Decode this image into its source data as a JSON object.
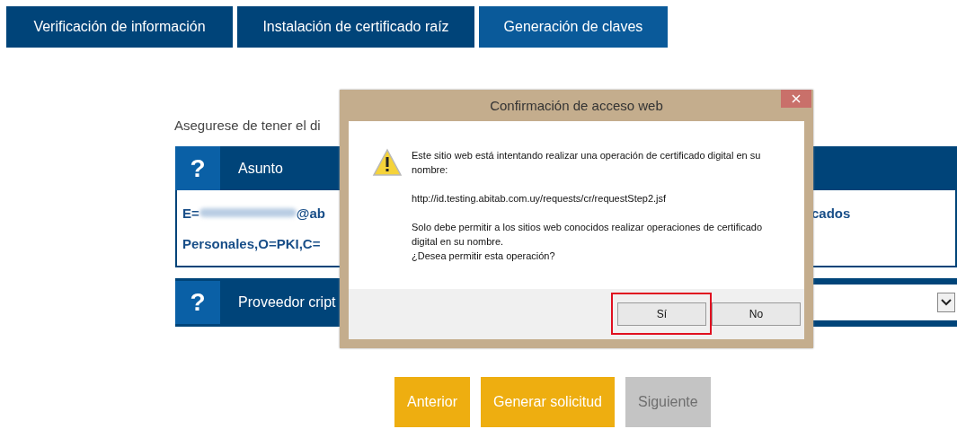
{
  "tabs": [
    {
      "label": "Verificación de información",
      "selected": false
    },
    {
      "label": "Instalación de certificado raíz",
      "selected": false
    },
    {
      "label": "Generación de claves",
      "selected": true
    }
  ],
  "intro": "Asegurese de tener el di",
  "subject_panel": {
    "help_mark": "?",
    "title": "Asunto",
    "line_1_start": "E=",
    "line_1_after_redaction": "@ab",
    "line_1_end": "cados",
    "line_2": "Personales,O=PKI,C="
  },
  "provider_panel": {
    "help_mark": "?",
    "title": "Proveedor cript"
  },
  "buttons": [
    {
      "label": "Anterior",
      "disabled": false
    },
    {
      "label": "Generar solicitud",
      "disabled": false
    },
    {
      "label": "Siguiente",
      "disabled": true
    }
  ],
  "dialog": {
    "title": "Confirmación de acceso web",
    "message": "Este sitio web está intentando realizar una operación de certificado digital en su nombre:",
    "url": "http://id.testing.abitab.com.uy/requests/cr/requestStep2.jsf",
    "warning": "Solo debe permitir a los sitios web conocidos realizar operaciones de certificado digital en su nombre.",
    "question": "¿Desea permitir esta operación?",
    "buttons": [
      {
        "label": "Sí",
        "highlighted": true
      },
      {
        "label": "No",
        "highlighted": false
      }
    ]
  }
}
